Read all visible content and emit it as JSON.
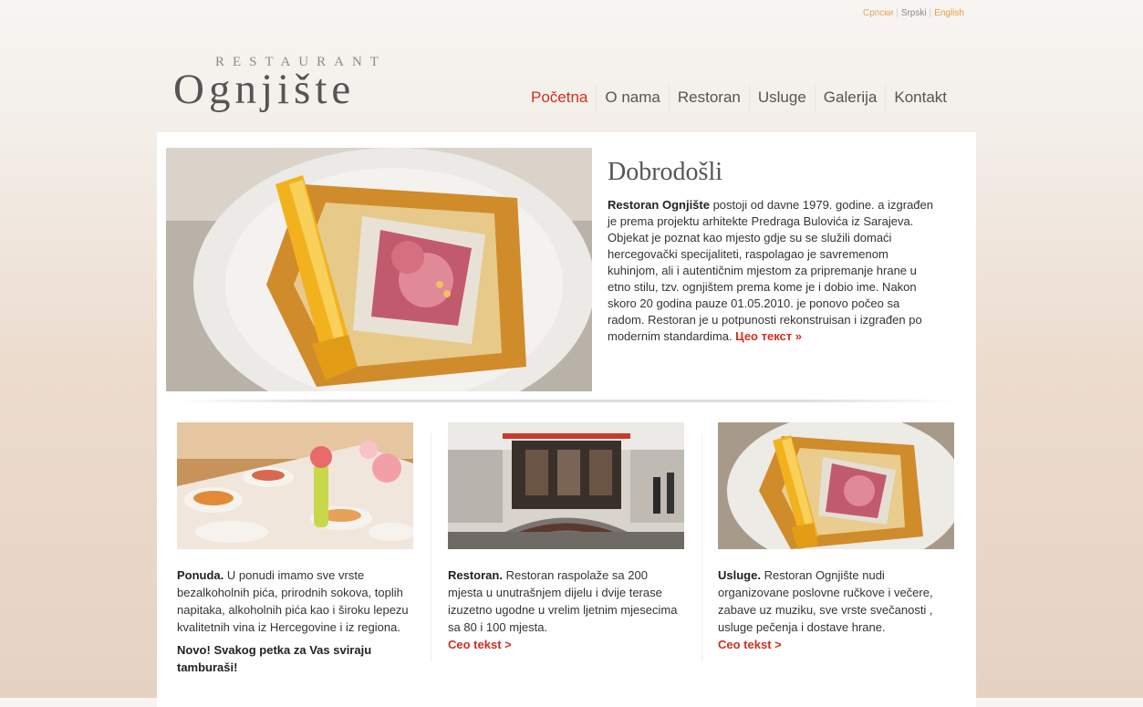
{
  "languages": {
    "cyrillic": "Српски",
    "serbian": "Srpski",
    "english": "English",
    "separator": "|"
  },
  "logo": {
    "small": "RESTAURANT",
    "big": "Ognjište"
  },
  "nav": [
    {
      "label": "Početna",
      "active": true
    },
    {
      "label": "O nama"
    },
    {
      "label": "Restoran"
    },
    {
      "label": "Usluge"
    },
    {
      "label": "Galerija"
    },
    {
      "label": "Kontakt"
    }
  ],
  "hero": {
    "title": "Dobrodošli",
    "lead": "Restoran Ognjište",
    "body": " postoji od davne 1979. godine. a izgrađen je prema projektu arhitekte Predraga Bulovića iz Sarajeva. Objekat je poznat kao mjesto gdje su se služili domaći hercegovački specijaliteti, raspolagao je savremenom kuhinjom, ali i autentičnim mjestom za pripremanje hrane u etno stilu, tzv. ognjištem prema kome je i dobio ime. Nakon skoro 20 godina pauze 01.05.2010. je ponovo počeo sa radom. Restoran je u potpunosti rekonstruisan i izgrađen po modernim standardima. ",
    "more": "Цео текст »"
  },
  "columns": [
    {
      "lead": "Ponuda.",
      "body": " U ponudi imamo sve vrste bezalkoholnih pića, prirodnih sokova, toplih napitaka, alkoholnih pića kao i široku lepezu kvalitetnih vina iz Hercegovine i iz regiona.",
      "news": "Novo! Svakog petka za Vas sviraju tamburaši!"
    },
    {
      "lead": "Restoran.",
      "body": " Restoran raspolaže sa 200 mjesta u unutrašnjem dijelu i dvije terase izuzetno ugodne u vrelim ljetnim mjesecima sa 80 i 100 mjesta.",
      "more": "Ceo tekst >"
    },
    {
      "lead": "Usluge.",
      "body": " Restoran Ognjište nudi organizovane poslovne ručkove i večere, zabave uz muziku, sve vrste svečanosti , usluge pečenja i dostave hrane.",
      "more": "Ceo tekst >"
    }
  ]
}
